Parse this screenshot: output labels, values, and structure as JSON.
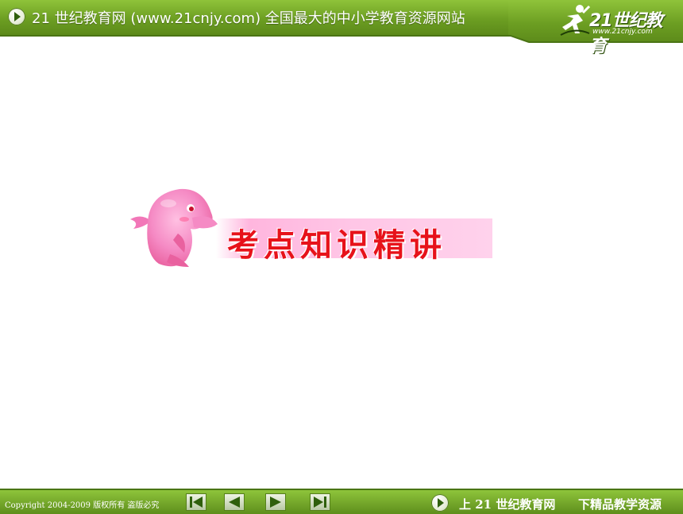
{
  "header": {
    "title": "21 世纪教育网 (www.21cnjy.com)  全国最大的中小学教育资源网站",
    "logo_text": "21世纪教育",
    "logo_url": "www.21cnjy.com"
  },
  "main": {
    "banner_text": "考点知识精讲"
  },
  "footer": {
    "copyright": "Copyright 2004-2009 版权所有 盗版必究",
    "link_up": "上 21 世纪教育网",
    "link_down": "下精品教学资源"
  },
  "icons": {
    "header_play": "circle-play-icon",
    "first": "first-page-icon",
    "prev": "prev-page-icon",
    "next": "next-page-icon",
    "last": "last-page-icon",
    "logo": "runner-logo-icon",
    "mascot": "dolphin-mascot-icon"
  },
  "colors": {
    "theme_green": "#6c9e22",
    "banner_pink": "#ffb6de",
    "banner_text_red": "#e7121a",
    "dolphin_pink": "#f277b8"
  }
}
